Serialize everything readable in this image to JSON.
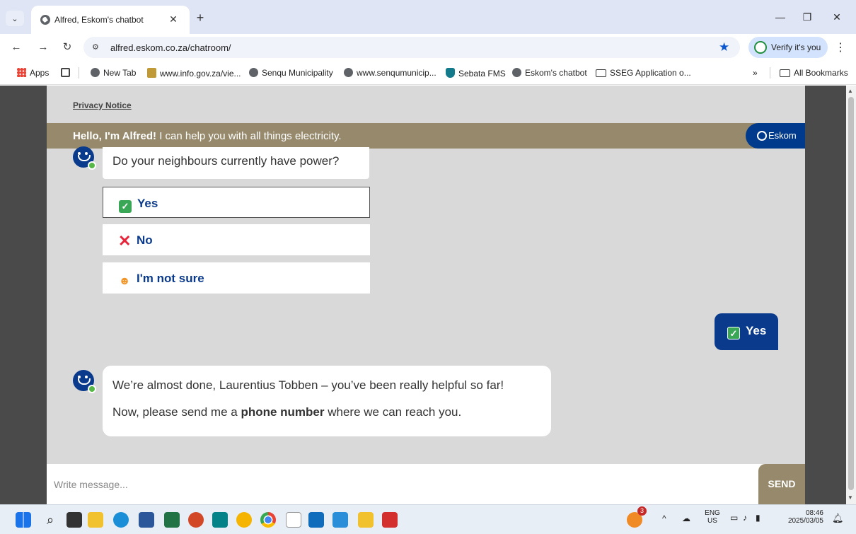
{
  "browser": {
    "tab_title": "Alfred, Eskom's chatbot",
    "url": "alfred.eskom.co.za/chatroom/",
    "verify_label": "Verify it's you",
    "bookmarks": [
      {
        "label": "Apps",
        "icon": "apps-icon"
      },
      {
        "label": "New Tab",
        "icon": "globe-icon"
      },
      {
        "label": "www.info.gov.za/vie...",
        "icon": "coat-of-arms-icon"
      },
      {
        "label": "Senqu Municipality",
        "icon": "globe-icon"
      },
      {
        "label": "www.senqumunicip...",
        "icon": "globe-icon"
      },
      {
        "label": "Sebata FMS",
        "icon": "shield-icon"
      },
      {
        "label": "Eskom's chatbot",
        "icon": "globe-icon"
      },
      {
        "label": "SSEG Application o...",
        "icon": "folder-icon"
      }
    ],
    "more_bookmarks": "»",
    "all_bookmarks": "All Bookmarks"
  },
  "chat": {
    "privacy_notice": "Privacy Notice",
    "header": {
      "greeting_strong": "Hello, I'm Alfred!",
      "greeting_rest": " I can help you with all things electricity.",
      "brand": "Eskom"
    },
    "question": "Do your neighbours currently have power?",
    "options": [
      {
        "label": "Yes",
        "icon": "check-icon",
        "selected": true
      },
      {
        "label": "No",
        "icon": "cross-icon",
        "selected": false
      },
      {
        "label": "I'm not sure",
        "icon": "shrug-icon",
        "selected": false
      }
    ],
    "user_reply": "Yes",
    "bot_message": {
      "line1": "We’re almost done, Laurentius Tobben – you’ve been really helpful so far!",
      "line2_before": "Now, please send me a ",
      "line2_strong": "phone number",
      "line2_after": " where we can reach you."
    },
    "composer": {
      "placeholder": "Write message...",
      "send_label": "SEND"
    }
  },
  "taskbar": {
    "notification_count": "3",
    "language": "ENG",
    "region": "US",
    "time": "08:46",
    "date": "2025/03/05"
  },
  "colors": {
    "eskom_blue": "#0a3a8c",
    "header_tan": "#978a6c",
    "chat_bg": "#d9d9d9",
    "check_green": "#3aa757",
    "cross_red": "#e8243a"
  }
}
